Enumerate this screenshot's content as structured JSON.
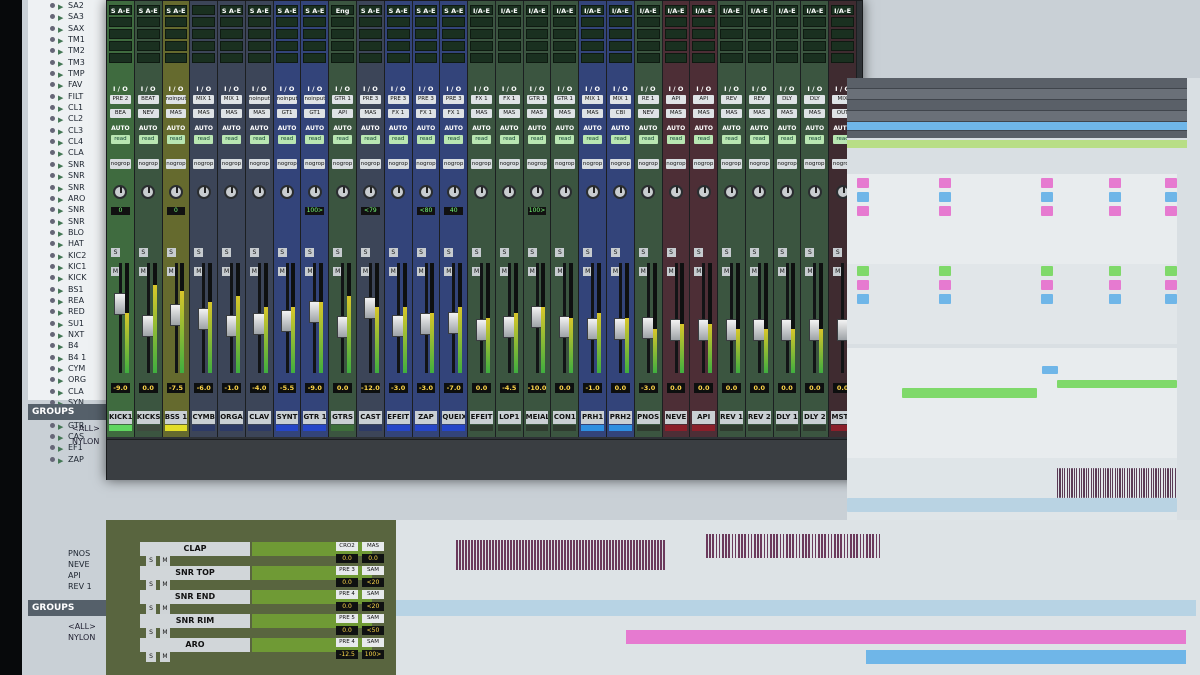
{
  "tracks_list": {
    "items": [
      "SA2",
      "SA3",
      "SAX",
      "TM1",
      "TM2",
      "TM3",
      "TMP",
      "FAV",
      "FILT",
      "CL1",
      "CL2",
      "CL3",
      "CL4",
      "CLA",
      "SNR",
      "SNR",
      "SNR",
      "ARO",
      "SNR",
      "SNR",
      "BLO",
      "HAT",
      "KIC2",
      "KIC1",
      "KICK",
      "BS1",
      "REA",
      "RED",
      "SU1",
      "NXT",
      "B4",
      "B4 1",
      "CYM",
      "ORG",
      "CLA",
      "SYN",
      "GT1",
      "GTR",
      "CAS",
      "EF1",
      "ZAP"
    ]
  },
  "groups": {
    "title": "GROUPS",
    "items": [
      "<ALL>",
      "NYLON"
    ]
  },
  "mixer": {
    "strips": [
      {
        "name": "KICK1",
        "color": "#5fd65f",
        "body": "#3f6b3f",
        "insert": "S A-E",
        "io_in": "PRE 2",
        "io_out": "BEA",
        "vol": "-9.0",
        "pan": "0",
        "knob": true,
        "fader": 0.55,
        "meter": 0.55
      },
      {
        "name": "KICKS",
        "color": "#3e4a3e",
        "body": "#3b5540",
        "insert": "S A-E",
        "io_in": "BEAT",
        "io_out": "NEV",
        "vol": "0.0",
        "pan": "",
        "knob": false,
        "fader": 0.3,
        "meter": 0.8
      },
      {
        "name": "BSS 1",
        "color": "#e3de28",
        "body": "#656a2e",
        "insert": "S A-E",
        "io_in": "noinput",
        "io_out": "MAS",
        "vol": "-7.5",
        "pan": "0",
        "knob": true,
        "fader": 0.42,
        "meter": 0.75
      },
      {
        "name": "CYMB",
        "color": "#2d3a66",
        "body": "#3c4558",
        "insert": "",
        "io_in": "MIX 1",
        "io_out": "MAS",
        "vol": "-6.0",
        "pan": "",
        "knob": false,
        "fader": 0.38,
        "meter": 0.65
      },
      {
        "name": "ORGA",
        "color": "#2d3a66",
        "body": "#3c4558",
        "insert": "S A-E",
        "io_in": "MIX 1",
        "io_out": "MAS",
        "vol": "-1.0",
        "pan": "",
        "knob": false,
        "fader": 0.3,
        "meter": 0.7
      },
      {
        "name": "CLAV",
        "color": "#2d3a66",
        "body": "#3c4558",
        "insert": "S A-E",
        "io_in": "noinput",
        "io_out": "MAS",
        "vol": "-4.0",
        "pan": "",
        "knob": true,
        "fader": 0.32,
        "meter": 0.6
      },
      {
        "name": "SYNT",
        "color": "#2646c8",
        "body": "#33447a",
        "insert": "S A-E",
        "io_in": "noinput",
        "io_out": "GT1",
        "vol": "-5.5",
        "pan": "",
        "knob": true,
        "fader": 0.35,
        "meter": 0.6
      },
      {
        "name": "GTR 1",
        "color": "#2646c8",
        "body": "#33447a",
        "insert": "S A-E",
        "io_in": "noinput",
        "io_out": "GT1",
        "vol": "-9.0",
        "pan": "100>",
        "knob": true,
        "fader": 0.45,
        "meter": 0.65
      },
      {
        "name": "GTRS",
        "color": "#3d6e3a",
        "body": "#3b5540",
        "insert": "Eng",
        "io_in": "GTR 1",
        "io_out": "API",
        "vol": "0.0",
        "pan": "",
        "knob": false,
        "fader": 0.28,
        "meter": 0.7
      },
      {
        "name": "CAST",
        "color": "#2d3a66",
        "body": "#3c4558",
        "insert": "S A-E",
        "io_in": "PRE 3",
        "io_out": "MAS",
        "vol": "-12.0",
        "pan": "<79",
        "knob": true,
        "fader": 0.5,
        "meter": 0.6
      },
      {
        "name": "EFEIT",
        "color": "#2646c8",
        "body": "#33447a",
        "insert": "S A-E",
        "io_in": "PRE 3",
        "io_out": "FX 1",
        "vol": "-3.0",
        "pan": "",
        "knob": true,
        "fader": 0.3,
        "meter": 0.6
      },
      {
        "name": "ZAP",
        "color": "#2646c8",
        "body": "#33447a",
        "insert": "S A-E",
        "io_in": "PRE 3",
        "io_out": "FX 1",
        "vol": "-3.0",
        "pan": "<80",
        "knob": true,
        "fader": 0.32,
        "meter": 0.55
      },
      {
        "name": "QUEIX",
        "color": "#2646c8",
        "body": "#33447a",
        "insert": "S A-E",
        "io_in": "PRE 3",
        "io_out": "FX 1",
        "vol": "-7.0",
        "pan": "40",
        "knob": true,
        "fader": 0.33,
        "meter": 0.6
      },
      {
        "name": "EFEIT",
        "color": "#2f3b2f",
        "body": "#3b5540",
        "insert": "I/A-E",
        "io_in": "FX 1",
        "io_out": "MAS",
        "vol": "0.0",
        "pan": "",
        "knob": false,
        "fader": 0.25,
        "meter": 0.5
      },
      {
        "name": "LOP1",
        "color": "#2f3b2f",
        "body": "#3b5540",
        "insert": "I/A-E",
        "io_in": "FX 1",
        "io_out": "MAS",
        "vol": "-4.5",
        "pan": "",
        "knob": false,
        "fader": 0.28,
        "meter": 0.55
      },
      {
        "name": "MEIAL",
        "color": "#2f3b2f",
        "body": "#3b5540",
        "insert": "I/A-E",
        "io_in": "GTR 1",
        "io_out": "MAS",
        "vol": "-10.0",
        "pan": "100>",
        "knob": false,
        "fader": 0.4,
        "meter": 0.6
      },
      {
        "name": "CON1",
        "color": "#2f3b2f",
        "body": "#3b5540",
        "insert": "I/A-E",
        "io_in": "GTR 1",
        "io_out": "MAS",
        "vol": "0.0",
        "pan": "",
        "knob": false,
        "fader": 0.28,
        "meter": 0.5
      },
      {
        "name": "PRH1",
        "color": "#2e8fe0",
        "body": "#33447a",
        "insert": "I/A-E",
        "io_in": "MIX 1",
        "io_out": "MAS",
        "vol": "-1.0",
        "pan": "",
        "knob": false,
        "fader": 0.26,
        "meter": 0.55
      },
      {
        "name": "PRH2",
        "color": "#2e8fe0",
        "body": "#33447a",
        "insert": "I/A-E",
        "io_in": "MIX 1",
        "io_out": "CBI",
        "vol": "0.0",
        "pan": "",
        "knob": false,
        "fader": 0.26,
        "meter": 0.5
      },
      {
        "name": "PNOS",
        "color": "#2f3b2f",
        "body": "#3b5540",
        "insert": "I/A-E",
        "io_in": "RE 1",
        "io_out": "NEV",
        "vol": "-3.0",
        "pan": "",
        "knob": false,
        "fader": 0.27,
        "meter": 0.4
      },
      {
        "name": "NEVE",
        "color": "#8a1f2a",
        "body": "#4d2e36",
        "insert": "I/A-E",
        "io_in": "API",
        "io_out": "MAS",
        "vol": "0.0",
        "pan": "",
        "knob": false,
        "fader": 0.25,
        "meter": 0.45
      },
      {
        "name": "API",
        "color": "#8a1f2a",
        "body": "#4d2e36",
        "insert": "I/A-E",
        "io_in": "API",
        "io_out": "MAS",
        "vol": "0.0",
        "pan": "",
        "knob": false,
        "fader": 0.25,
        "meter": 0.45
      },
      {
        "name": "REV 1",
        "color": "#2f3b2f",
        "body": "#3b5540",
        "insert": "I/A-E",
        "io_in": "REV",
        "io_out": "MAS",
        "vol": "0.0",
        "pan": "",
        "knob": false,
        "fader": 0.25,
        "meter": 0.4
      },
      {
        "name": "REV 2",
        "color": "#2f3b2f",
        "body": "#3b5540",
        "insert": "I/A-E",
        "io_in": "REV",
        "io_out": "MAS",
        "vol": "0.0",
        "pan": "",
        "knob": false,
        "fader": 0.25,
        "meter": 0.4
      },
      {
        "name": "DLY 1",
        "color": "#2f3b2f",
        "body": "#3b5540",
        "insert": "I/A-E",
        "io_in": "DLY",
        "io_out": "MAS",
        "vol": "0.0",
        "pan": "",
        "knob": false,
        "fader": 0.25,
        "meter": 0.4
      },
      {
        "name": "DLY 2",
        "color": "#2f3b2f",
        "body": "#3b5540",
        "insert": "I/A-E",
        "io_in": "DLY",
        "io_out": "MAS",
        "vol": "0.0",
        "pan": "",
        "knob": false,
        "fader": 0.25,
        "meter": 0.4
      },
      {
        "name": "MSTR",
        "color": "#8a1f2a",
        "body": "#3f2b30",
        "insert": "I/A-E",
        "io_in": "MIX",
        "io_out": "OUT",
        "vol": "0.0",
        "pan": "",
        "knob": false,
        "fader": 0.25,
        "meter": 0.5
      }
    ],
    "labels": {
      "io": "I / O",
      "auto": "AUTO",
      "read": "read",
      "nogrp": "nogrop",
      "solo": "S",
      "mute": "M"
    }
  },
  "lower_tracks": [
    {
      "name": "CLAP",
      "pre": "CRO2",
      "out": "MAS",
      "val1": "0.0",
      "val2": "0.0"
    },
    {
      "name": "SNR TOP",
      "pre": "PRE 3",
      "out": "SAM",
      "val1": "0.0",
      "val2": "<20"
    },
    {
      "name": "SNR END",
      "pre": "PRE 4",
      "out": "SAM",
      "val1": "0.0",
      "val2": "<20"
    },
    {
      "name": "SNR RIM",
      "pre": "PRE 5",
      "out": "SAM",
      "val1": "0.0",
      "val2": "<50"
    },
    {
      "name": "ARO",
      "pre": "PRE 4",
      "out": "SAM",
      "val1": "-12.5",
      "val2": "100>"
    }
  ],
  "lower_side": {
    "items": [
      "PNOS",
      "NEVE",
      "API",
      "REV 1"
    ],
    "groups_title": "GROUPS",
    "groups": [
      "<ALL>",
      "NYLON"
    ]
  },
  "colors": {
    "green_clip": "#7fd96a",
    "pink_clip": "#e67ad0",
    "blue_clip": "#6fb6e8",
    "timeline_bg": "#d9dfe3"
  }
}
